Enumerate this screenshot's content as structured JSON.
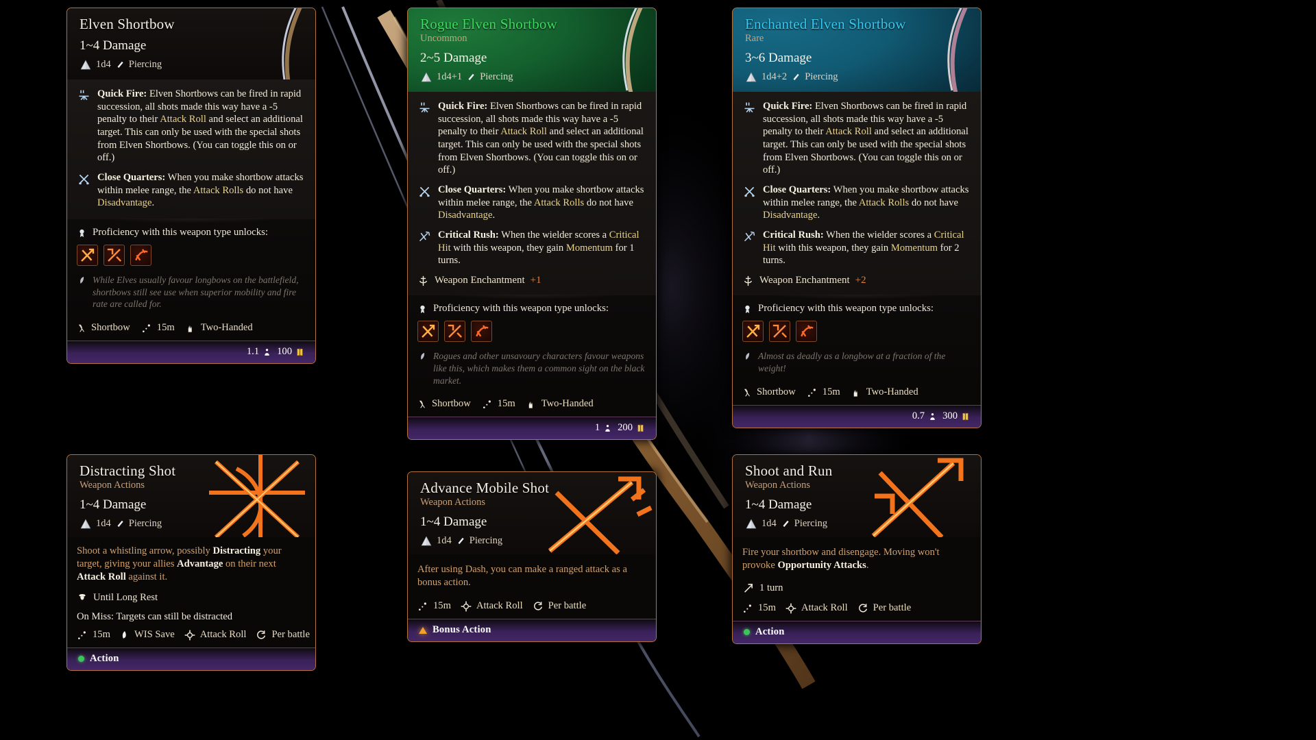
{
  "scene": {
    "background": "#000000",
    "accent_border": "#b5723a"
  },
  "icons": {
    "die": "d4-die-icon",
    "piercing": "piercing-damage-icon",
    "quick_fire": "quick-fire-icon",
    "close_quarters": "close-quarters-icon",
    "critical_rush": "critical-rush-icon",
    "enchantment": "weapon-enchantment-icon",
    "proficiency": "proficiency-medal-icon",
    "flavor": "quill-icon",
    "shortbow": "shortbow-icon",
    "range": "range-icon",
    "two_handed": "two-handed-icon",
    "weight": "weight-icon",
    "gold": "gold-coin-icon",
    "recharge_long_rest": "long-rest-icon",
    "recharge_turn": "turn-timer-icon",
    "save": "saving-throw-icon",
    "attack_roll": "attack-roll-icon",
    "per_battle": "per-battle-icon"
  },
  "shared": {
    "quick_fire": {
      "name": "Quick Fire:",
      "parts": [
        {
          "t": " Elven Shortbows can be fired in rapid succession, all shots made this way have a -5 penalty to their ",
          "s": "n"
        },
        {
          "t": "Attack Roll",
          "s": "hl"
        },
        {
          "t": " and select an additional target. This can only be used with the special shots from Elven Shortbows. (You can toggle this on or off.)",
          "s": "n"
        }
      ]
    },
    "close_quarters": {
      "name": "Close Quarters:",
      "parts": [
        {
          "t": " When you make shortbow attacks within melee range, the ",
          "s": "n"
        },
        {
          "t": "Attack Rolls",
          "s": "hl"
        },
        {
          "t": " do not have ",
          "s": "n"
        },
        {
          "t": "Disadvantage",
          "s": "hl"
        },
        {
          "t": ".",
          "s": "n"
        }
      ]
    },
    "proficiency_label": "Proficiency with this weapon type unlocks:",
    "stat_shortbow": "Shortbow",
    "stat_range": "15m",
    "stat_two_handed": "Two-Handed"
  },
  "cards": [
    {
      "id": "elven-shortbow",
      "kind": "weapon",
      "rarity_style": "plain",
      "title": "Elven Shortbow",
      "title_color": "#f4efe6",
      "subtitle": null,
      "damage": "1~4 Damage",
      "die": "1d4",
      "damage_type": "Piercing",
      "features": [
        {
          "icon": "quick-fire-icon",
          "ref": "quick_fire"
        },
        {
          "icon": "close-quarters-icon",
          "ref": "close_quarters"
        }
      ],
      "enchantment": null,
      "flavor": "While Elves usually favour longbows on the battlefield, shortbows still see use when superior mobility and fire rate are called for.",
      "stats": [
        "Shortbow",
        "15m",
        "Two-Handed"
      ],
      "weight": "1.1",
      "value": "100"
    },
    {
      "id": "rogue-elven-shortbow",
      "kind": "weapon",
      "rarity_style": "green",
      "title": "Rogue Elven Shortbow",
      "title_color": "#3ddc61",
      "subtitle": "Uncommon",
      "damage": "2~5 Damage",
      "die": "1d4+1",
      "damage_type": "Piercing",
      "features": [
        {
          "icon": "quick-fire-icon",
          "ref": "quick_fire"
        },
        {
          "icon": "close-quarters-icon",
          "ref": "close_quarters"
        },
        {
          "icon": "critical-rush-icon",
          "ref": "critical_rush_1"
        }
      ],
      "enchantment": {
        "label": "Weapon Enchantment",
        "value": "+1"
      },
      "flavor": "Rogues and other unsavoury characters favour weapons like this, which makes them a common sight on the black market.",
      "stats": [
        "Shortbow",
        "15m",
        "Two-Handed"
      ],
      "weight": "1",
      "value": "200"
    },
    {
      "id": "enchanted-elven-shortbow",
      "kind": "weapon",
      "rarity_style": "blue",
      "title": "Enchanted Elven Shortbow",
      "title_color": "#39c9f0",
      "subtitle": "Rare",
      "damage": "3~6 Damage",
      "die": "1d4+2",
      "damage_type": "Piercing",
      "features": [
        {
          "icon": "quick-fire-icon",
          "ref": "quick_fire"
        },
        {
          "icon": "close-quarters-icon",
          "ref": "close_quarters"
        },
        {
          "icon": "critical-rush-icon",
          "ref": "critical_rush_2"
        }
      ],
      "enchantment": {
        "label": "Weapon Enchantment",
        "value": "+2"
      },
      "flavor": "Almost as deadly as a longbow at a fraction of the weight!",
      "stats": [
        "Shortbow",
        "15m",
        "Two-Handed"
      ],
      "weight": "0.7",
      "value": "300"
    }
  ],
  "critical_rush_1": {
    "name": "Critical Rush:",
    "parts": [
      {
        "t": " When the wielder scores a ",
        "s": "n"
      },
      {
        "t": "Critical Hit",
        "s": "hl"
      },
      {
        "t": " with this weapon, they gain ",
        "s": "n"
      },
      {
        "t": "Momentum",
        "s": "hl"
      },
      {
        "t": " for 1 turns.",
        "s": "n"
      }
    ]
  },
  "critical_rush_2": {
    "name": "Critical Rush:",
    "parts": [
      {
        "t": " When the wielder scores a ",
        "s": "n"
      },
      {
        "t": "Critical Hit",
        "s": "hl"
      },
      {
        "t": " with this weapon, they gain ",
        "s": "n"
      },
      {
        "t": "Momentum",
        "s": "hl"
      },
      {
        "t": " for 2 turns.",
        "s": "n"
      }
    ]
  },
  "actions": [
    {
      "id": "distracting-shot",
      "title": "Distracting Shot",
      "subtitle": "Weapon Actions",
      "damage": "1~4 Damage",
      "die": "1d4",
      "damage_type": "Piercing",
      "desc_parts": [
        {
          "t": "Shoot a whistling arrow, possibly ",
          "s": "n"
        },
        {
          "t": "Distracting",
          "s": "b"
        },
        {
          "t": " your target, giving your allies ",
          "s": "n"
        },
        {
          "t": "Advantage",
          "s": "b"
        },
        {
          "t": " on their next ",
          "s": "n"
        },
        {
          "t": "Attack Roll",
          "s": "b"
        },
        {
          "t": " against it.",
          "s": "n"
        }
      ],
      "recharge": {
        "icon": "long-rest-icon",
        "label": "Until Long Rest"
      },
      "on_miss": "On Miss: Targets can still be distracted",
      "meta": [
        {
          "icon": "range-icon",
          "label": "15m"
        },
        {
          "icon": "saving-throw-icon",
          "label": "WIS Save"
        },
        {
          "icon": "attack-roll-icon",
          "label": "Attack Roll"
        },
        {
          "icon": "per-battle-icon",
          "label": "Per battle"
        }
      ],
      "cost": {
        "type": "Action",
        "marker": "green-dot"
      }
    },
    {
      "id": "advance-mobile-shot",
      "title": "Advance Mobile Shot",
      "subtitle": "Weapon Actions",
      "damage": "1~4 Damage",
      "die": "1d4",
      "damage_type": "Piercing",
      "desc_parts": [
        {
          "t": "After using Dash, you can make a ranged attack as a bonus action.",
          "s": "n"
        }
      ],
      "recharge": null,
      "on_miss": null,
      "meta": [
        {
          "icon": "range-icon",
          "label": "15m"
        },
        {
          "icon": "attack-roll-icon",
          "label": "Attack Roll"
        },
        {
          "icon": "per-battle-icon",
          "label": "Per battle"
        }
      ],
      "cost": {
        "type": "Bonus Action",
        "marker": "orange-triangle"
      }
    },
    {
      "id": "shoot-and-run",
      "title": "Shoot and Run",
      "subtitle": "Weapon Actions",
      "damage": "1~4 Damage",
      "die": "1d4",
      "damage_type": "Piercing",
      "desc_parts": [
        {
          "t": "Fire your shortbow and disengage. Moving won't provoke ",
          "s": "n"
        },
        {
          "t": "Opportunity Attacks",
          "s": "b"
        },
        {
          "t": ".",
          "s": "n"
        }
      ],
      "recharge": {
        "icon": "turn-timer-icon",
        "label": "1 turn"
      },
      "on_miss": null,
      "meta": [
        {
          "icon": "range-icon",
          "label": "15m"
        },
        {
          "icon": "attack-roll-icon",
          "label": "Attack Roll"
        },
        {
          "icon": "per-battle-icon",
          "label": "Per battle"
        }
      ],
      "cost": {
        "type": "Action",
        "marker": "green-dot"
      }
    }
  ]
}
